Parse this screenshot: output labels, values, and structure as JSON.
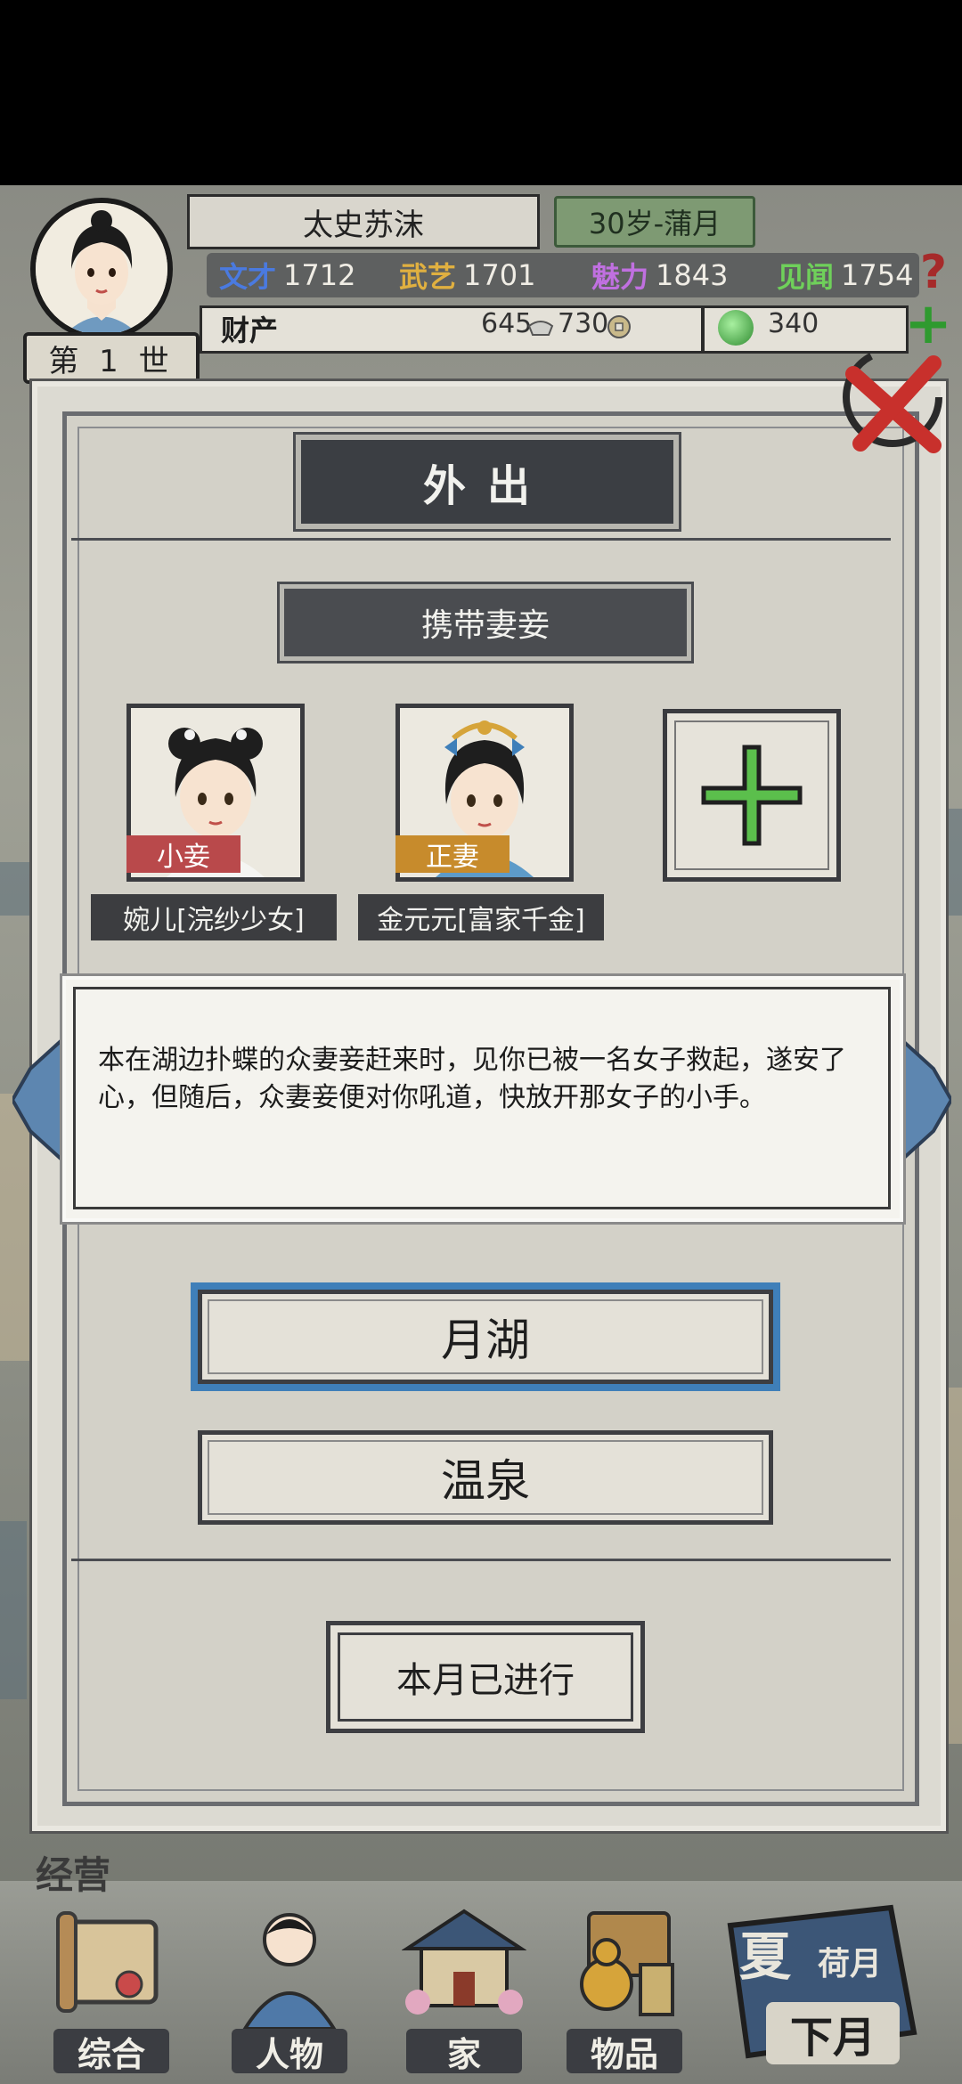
{
  "header": {
    "name": "太史苏沫",
    "age_season": "30岁-蒲月",
    "generation": "第 1 世",
    "stats": [
      {
        "label": "文才",
        "value": "1712",
        "color": "#3f6fd6"
      },
      {
        "label": "武艺",
        "value": "1701",
        "color": "#d6a43a"
      },
      {
        "label": "魅力",
        "value": "1843",
        "color": "#b65fcf"
      },
      {
        "label": "见闻",
        "value": "1754",
        "color": "#5fbf4a"
      }
    ],
    "assets": {
      "label": "财产",
      "silver": "645",
      "copper": "730",
      "gems": "340"
    }
  },
  "dialog": {
    "title": "外出",
    "subtitle": "携带妻妾",
    "companions": [
      {
        "role": "小妾",
        "role_color": "#b9494b",
        "name": "婉儿[浣纱少女]"
      },
      {
        "role": "正妻",
        "role_color": "#c78b2c",
        "name": "金元元[富家千金]"
      }
    ],
    "popup_text": "本在湖边扑蝶的众妻妾赶来时，见你已被一名女子救起，遂安了心，但随后，众妻妾便对你吼道，快放开那女子的小手。",
    "options": [
      "月湖",
      "温泉"
    ],
    "done_label": "本月已进行"
  },
  "bottom": {
    "section_label": "经营",
    "nav": [
      {
        "label": "综合",
        "icon": "scroll-icon"
      },
      {
        "label": "人物",
        "icon": "person-icon"
      },
      {
        "label": "家",
        "icon": "house-icon"
      },
      {
        "label": "物品",
        "icon": "items-icon"
      }
    ],
    "season": "夏",
    "month": "荷月",
    "next_month_label": "下月"
  }
}
